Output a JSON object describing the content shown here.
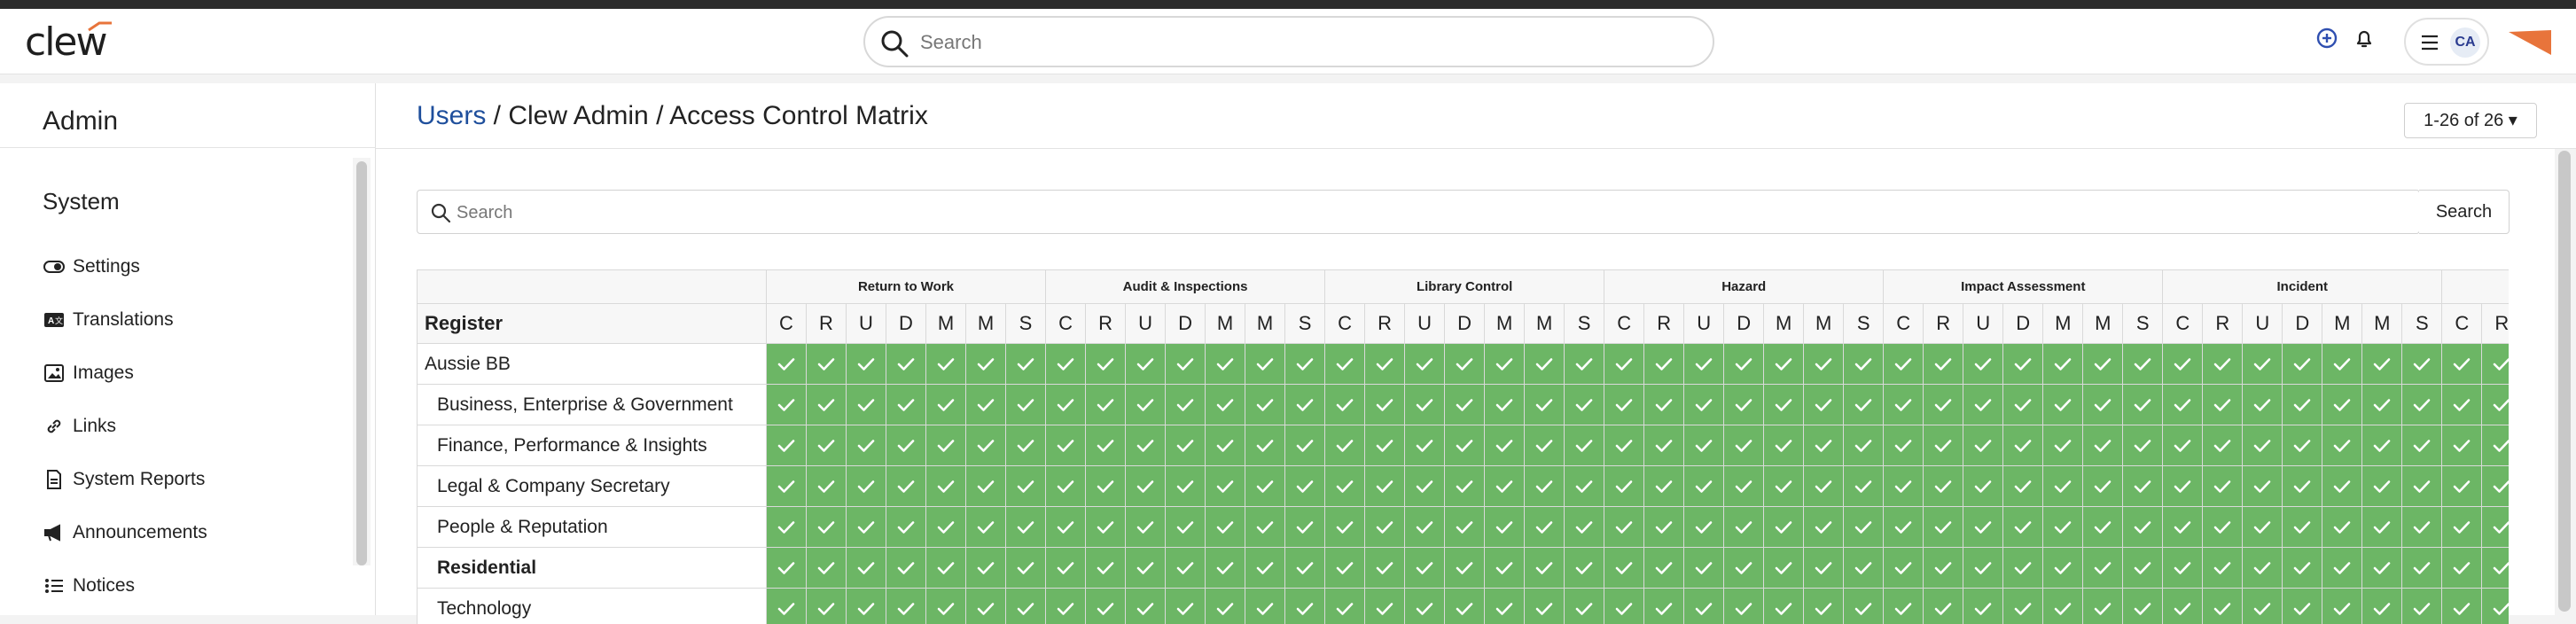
{
  "app": {
    "logo_text": "clew"
  },
  "topbar": {
    "search_placeholder": "Search",
    "user_initials": "CA",
    "brand_color": "#e8743b"
  },
  "sidebar": {
    "title": "Admin",
    "section": "System",
    "items": [
      {
        "label": "Settings",
        "icon": "toggle-icon"
      },
      {
        "label": "Translations",
        "icon": "translation-icon"
      },
      {
        "label": "Images",
        "icon": "image-icon"
      },
      {
        "label": "Links",
        "icon": "link-icon"
      },
      {
        "label": "System Reports",
        "icon": "report-icon"
      },
      {
        "label": "Announcements",
        "icon": "megaphone-icon"
      },
      {
        "label": "Notices",
        "icon": "list-icon"
      }
    ]
  },
  "header": {
    "crumb_users": "Users",
    "crumb_rest": " / Clew Admin / Access Control Matrix",
    "pager": "1-26 of 26 ▾"
  },
  "table_search": {
    "placeholder": "Search",
    "button": "Search"
  },
  "matrix": {
    "register_header": "Register",
    "groups": [
      "Return to Work",
      "Audit & Inspections",
      "Library Control",
      "Hazard",
      "Impact Assessment",
      "Incident",
      ""
    ],
    "permissions": [
      "C",
      "R",
      "U",
      "D",
      "M",
      "M",
      "S"
    ],
    "rows": [
      {
        "name": "Aussie BB",
        "style": "plain"
      },
      {
        "name": "Business, Enterprise & Government",
        "style": "indent"
      },
      {
        "name": "Finance, Performance & Insights",
        "style": "indent"
      },
      {
        "name": "Legal & Company Secretary",
        "style": "indent"
      },
      {
        "name": "People & Reputation",
        "style": "indent"
      },
      {
        "name": "Residential",
        "style": "bold"
      },
      {
        "name": "Technology",
        "style": "indent"
      }
    ],
    "granted_color": "#6cb665"
  }
}
